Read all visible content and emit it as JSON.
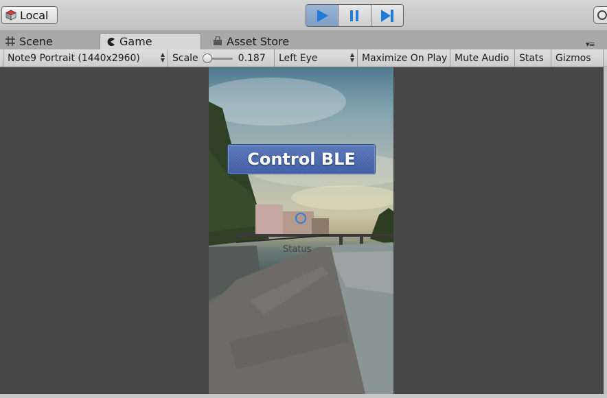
{
  "toolbar": {
    "local_label": "Local",
    "play_icon": "play-icon",
    "pause_icon": "pause-icon",
    "step_icon": "step-icon",
    "accent_color": "#1f7bd9"
  },
  "tabs": [
    {
      "label": "Scene",
      "icon": "grid-icon"
    },
    {
      "label": "Game",
      "icon": "pacman-icon",
      "active": true
    },
    {
      "label": "Asset Store",
      "icon": "store-bag-icon"
    }
  ],
  "gamebar": {
    "resolution": "Note9 Portrait (1440x2960)",
    "scale_label": "Scale",
    "scale_value": "0.187",
    "eye": "Left Eye",
    "maximize": "Maximize On Play",
    "mute": "Mute Audio",
    "stats": "Stats",
    "gizmos": "Gizmos"
  },
  "game": {
    "button_label": "Control BLE",
    "status_text": "Status"
  }
}
